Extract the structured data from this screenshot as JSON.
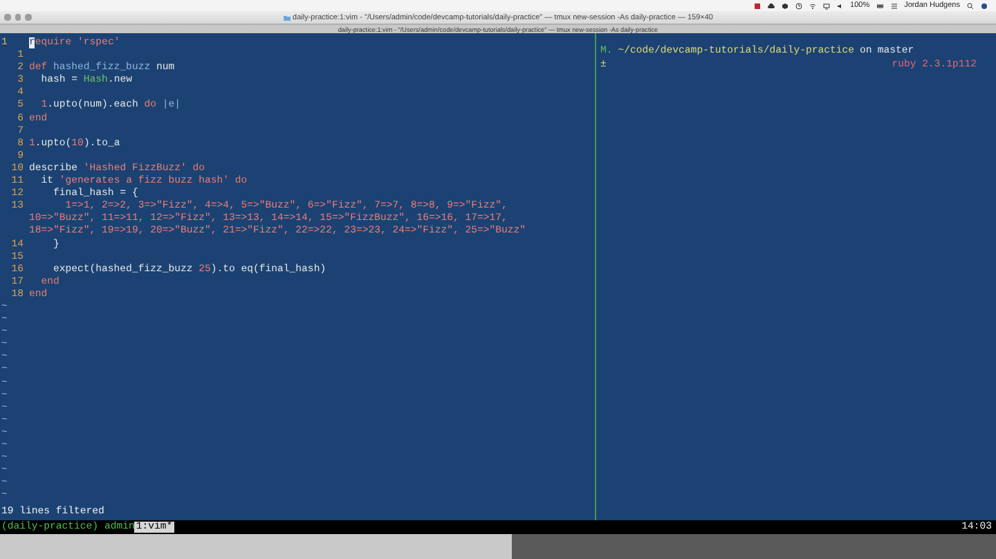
{
  "menu_bar": {
    "battery": "100%",
    "user": "Jordan Hudgens"
  },
  "window": {
    "title": "daily-practice:1:vim - \"/Users/admin/code/devcamp-tutorials/daily-practice\" — tmux new-session -As daily-practice — 159×40",
    "tab": "daily-practice:1:vim - \"/Users/admin/code/devcamp-tutorials/daily-practice\" — tmux new-session -As daily-practice"
  },
  "editor": {
    "lines": [
      {
        "number": "1",
        "current": true,
        "segments": [
          {
            "kind": "cursor",
            "text": "r"
          },
          {
            "kind": "keyword",
            "text": "equire "
          },
          {
            "kind": "string",
            "text": "'rspec'"
          }
        ]
      },
      {
        "number": "1",
        "current": false
      },
      {
        "number": "2",
        "current": false,
        "segments": [
          {
            "kind": "keyword",
            "text": "def "
          },
          {
            "kind": "ident",
            "text": "hashed_fizz_buzz"
          },
          {
            "kind": "plain",
            "text": " num"
          }
        ]
      },
      {
        "number": "3",
        "current": false,
        "segments": [
          {
            "kind": "plain",
            "text": "  hash = "
          },
          {
            "kind": "const",
            "text": "Hash"
          },
          {
            "kind": "plain",
            "text": ".new"
          }
        ]
      },
      {
        "number": "4",
        "current": false
      },
      {
        "number": "5",
        "current": false,
        "segments": [
          {
            "kind": "number",
            "text": "  1"
          },
          {
            "kind": "plain",
            "text": ".upto(num).each "
          },
          {
            "kind": "keyword",
            "text": "do "
          },
          {
            "kind": "ident",
            "text": "|e|"
          }
        ]
      },
      {
        "number": "6",
        "current": false,
        "segments": [
          {
            "kind": "keyword",
            "text": "end"
          }
        ]
      },
      {
        "number": "7",
        "current": false
      },
      {
        "number": "8",
        "current": false,
        "segments": [
          {
            "kind": "number",
            "text": "1"
          },
          {
            "kind": "plain",
            "text": ".upto("
          },
          {
            "kind": "number",
            "text": "10"
          },
          {
            "kind": "plain",
            "text": ").to_a"
          }
        ]
      },
      {
        "number": "9",
        "current": false
      },
      {
        "number": "10",
        "current": false,
        "segments": [
          {
            "kind": "plain",
            "text": "describe "
          },
          {
            "kind": "string",
            "text": "'Hashed FizzBuzz'"
          },
          {
            "kind": "keyword",
            "text": " do"
          }
        ]
      },
      {
        "number": "11",
        "current": false,
        "segments": [
          {
            "kind": "plain",
            "text": "  it "
          },
          {
            "kind": "string",
            "text": "'generates a fizz buzz hash'"
          },
          {
            "kind": "keyword",
            "text": " do"
          }
        ]
      },
      {
        "number": "12",
        "current": false,
        "segments": [
          {
            "kind": "plain",
            "text": "    final_hash = {"
          }
        ]
      },
      {
        "number": "13",
        "current": false,
        "segments": [
          {
            "kind": "string",
            "text": "      1=>1, 2=>2, 3=>\"Fizz\", 4=>4, 5=>\"Buzz\", 6=>\"Fizz\", 7=>7, 8=>8, 9=>\"Fizz\","
          }
        ]
      },
      {
        "segments": [
          {
            "kind": "string",
            "text": "10=>\"Buzz\", 11=>11, 12=>\"Fizz\", 13=>13, 14=>14, 15=>\"FizzBuzz\", 16=>16, 17=>17,"
          }
        ]
      },
      {
        "segments": [
          {
            "kind": "string",
            "text": "18=>\"Fizz\", 19=>19, 20=>\"Buzz\", 21=>\"Fizz\", 22=>22, 23=>23, 24=>\"Fizz\", 25=>\"Buzz\""
          }
        ]
      },
      {
        "number": "14",
        "current": false,
        "segments": [
          {
            "kind": "plain",
            "text": "    }"
          }
        ]
      },
      {
        "number": "15",
        "current": false
      },
      {
        "number": "16",
        "current": false,
        "segments": [
          {
            "kind": "plain",
            "text": "    expect(hashed_fizz_buzz "
          },
          {
            "kind": "number",
            "text": "25"
          },
          {
            "kind": "plain",
            "text": ").to eq(final_hash)"
          }
        ]
      },
      {
        "number": "17",
        "current": false,
        "segments": [
          {
            "kind": "keyword",
            "text": "  end"
          }
        ]
      },
      {
        "number": "18",
        "current": false,
        "segments": [
          {
            "kind": "keyword",
            "text": "end"
          }
        ]
      }
    ],
    "tildes": [
      "~",
      "~",
      "~",
      "~",
      "~",
      "~",
      "~",
      "~",
      "~",
      "~",
      "~",
      "~",
      "~",
      "~",
      "~",
      "~"
    ],
    "message": "19 lines filtered"
  },
  "shell": {
    "status": "M.",
    "path": "~/code/devcamp-tutorials/daily-practice",
    "on": "on",
    "branch": "master",
    "symbol": "±",
    "ruby": "ruby 2.3.1p112"
  },
  "status_bar": {
    "session": "(daily-practice) admin",
    "window": "1:vim*",
    "time": "14:03"
  }
}
